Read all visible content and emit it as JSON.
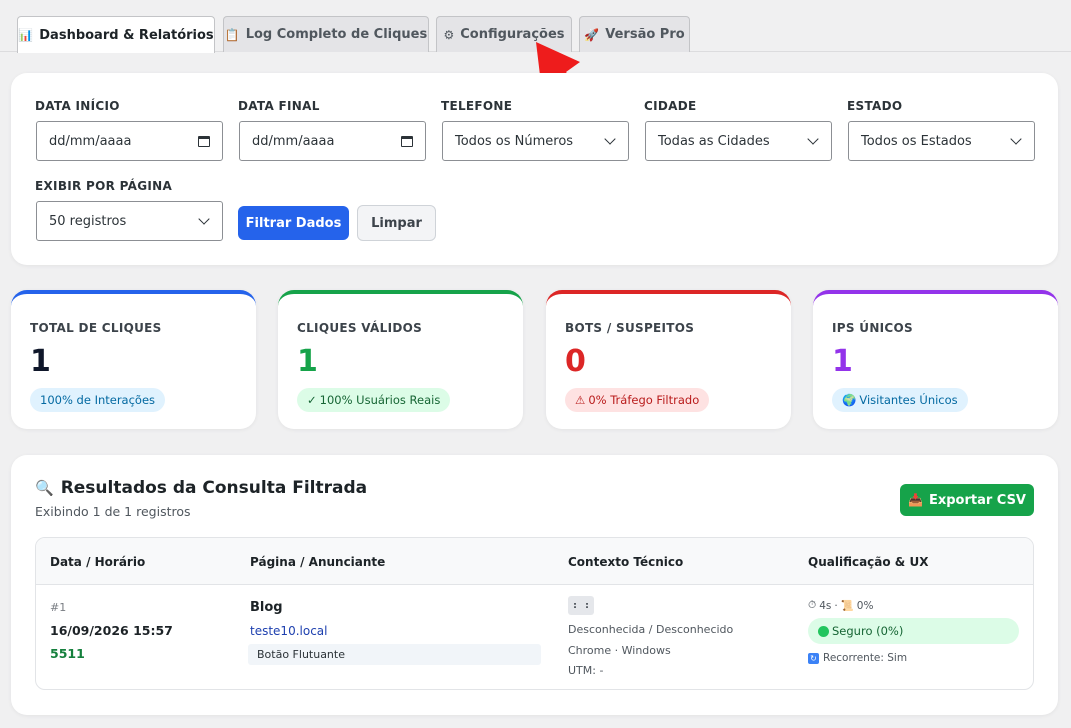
{
  "tabs": [
    {
      "label": "Dashboard & Relatórios",
      "icon": "bar-chart-icon",
      "glyph": "📊",
      "active": true
    },
    {
      "label": "Log Completo de Cliques",
      "icon": "clipboard-icon",
      "glyph": "📋",
      "active": false
    },
    {
      "label": "Configurações",
      "icon": "gear-icon",
      "glyph": "⚙",
      "active": false
    },
    {
      "label": "Versão Pro",
      "icon": "rocket-icon",
      "glyph": "🚀",
      "active": false
    }
  ],
  "filters": {
    "date_start": {
      "label": "DATA INÍCIO",
      "value": "dd/mm/aaaa"
    },
    "date_end": {
      "label": "DATA FINAL",
      "value": "dd/mm/aaaa"
    },
    "phone": {
      "label": "TELEFONE",
      "value": "Todos os Números"
    },
    "city": {
      "label": "CIDADE",
      "value": "Todas as Cidades"
    },
    "state": {
      "label": "ESTADO",
      "value": "Todos os Estados"
    },
    "per_page": {
      "label": "EXIBIR POR PÁGINA",
      "value": "50 registros"
    },
    "filter_button": "Filtrar Dados",
    "clear_button": "Limpar"
  },
  "stats": [
    {
      "label": "TOTAL DE CLIQUES",
      "value": "1",
      "pill": "100% de Interações",
      "pill_glyph": "",
      "color": "#2563eb",
      "value_color": "#0f172a",
      "pill_bg": "#e0f2fe",
      "pill_fg": "#0369a1"
    },
    {
      "label": "CLIQUES VÁLIDOS",
      "value": "1",
      "pill": "100% Usuários Reais",
      "pill_glyph": "✓",
      "color": "#16a34a",
      "value_color": "#16a34a",
      "pill_bg": "#dcfce7",
      "pill_fg": "#166534"
    },
    {
      "label": "BOTS / SUSPEITOS",
      "value": "0",
      "pill": "0% Tráfego Filtrado",
      "pill_glyph": "⚠",
      "color": "#dc2626",
      "value_color": "#dc2626",
      "pill_bg": "#fee2e2",
      "pill_fg": "#b91c1c"
    },
    {
      "label": "IPS ÚNICOS",
      "value": "1",
      "pill": "Visitantes Únicos",
      "pill_glyph": "🌍",
      "color": "#9333ea",
      "value_color": "#9333ea",
      "pill_bg": "#e0f2fe",
      "pill_fg": "#0369a1"
    }
  ],
  "results": {
    "title": "Resultados da Consulta Filtrada",
    "subtitle": "Exibindo 1 de 1 registros",
    "export_button": "Exportar CSV",
    "columns": [
      "Data / Horário",
      "Página / Anunciante",
      "Contexto Técnico",
      "Qualificação & UX"
    ],
    "row": {
      "id": "#1",
      "datetime": "16/09/2026 15:57",
      "phone": "5511",
      "page": "Blog",
      "domain": "teste10.local",
      "button": "Botão Flutuante",
      "ip": ": :",
      "location": "Desconhecida / Desconhecido",
      "browser": "Chrome · Windows",
      "utm": "UTM: -",
      "time": "4s",
      "scroll": "0%",
      "status": "Seguro (0%)",
      "recurrent": "Recorrente: Sim"
    }
  }
}
